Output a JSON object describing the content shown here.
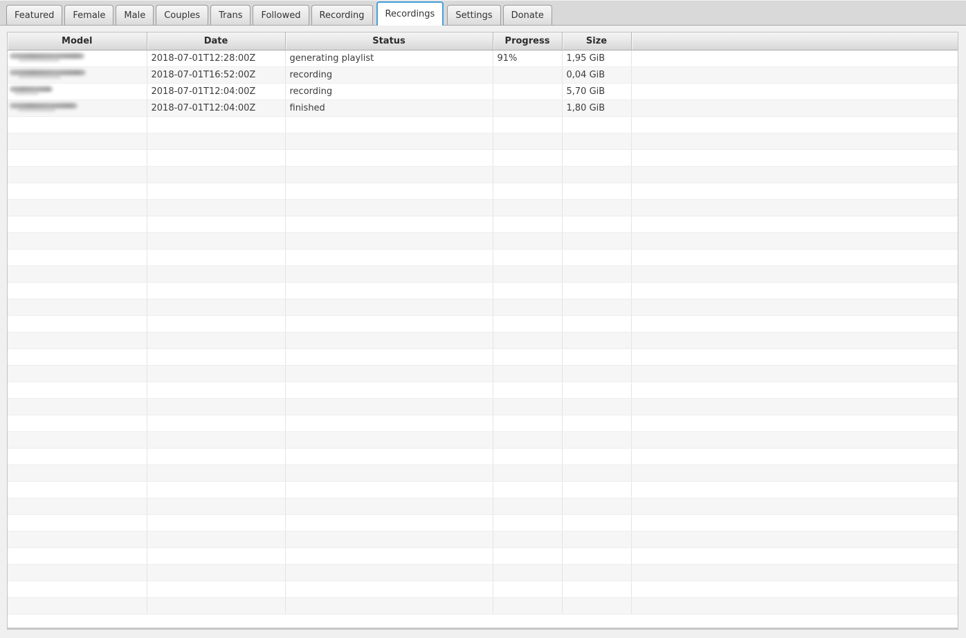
{
  "tabs": [
    {
      "label": "Featured",
      "active": false
    },
    {
      "label": "Female",
      "active": false
    },
    {
      "label": "Male",
      "active": false
    },
    {
      "label": "Couples",
      "active": false
    },
    {
      "label": "Trans",
      "active": false
    },
    {
      "label": "Followed",
      "active": false
    },
    {
      "label": "Recording",
      "active": false
    },
    {
      "label": "Recordings",
      "active": true
    },
    {
      "label": "Settings",
      "active": false
    },
    {
      "label": "Donate",
      "active": false
    }
  ],
  "table": {
    "columns": [
      {
        "key": "model",
        "label": "Model"
      },
      {
        "key": "date",
        "label": "Date"
      },
      {
        "key": "status",
        "label": "Status"
      },
      {
        "key": "progress",
        "label": "Progress"
      },
      {
        "key": "size",
        "label": "Size"
      },
      {
        "key": "spacer",
        "label": ""
      }
    ],
    "rows": [
      {
        "model_redacted": true,
        "model_blur_width": 108,
        "date": "2018-07-01T12:28:00Z",
        "status": "generating playlist",
        "progress": "91%",
        "size": "1,95 GiB"
      },
      {
        "model_redacted": true,
        "model_blur_width": 110,
        "date": "2018-07-01T16:52:00Z",
        "status": "recording",
        "progress": "",
        "size": "0,04 GiB"
      },
      {
        "model_redacted": true,
        "model_blur_width": 62,
        "date": "2018-07-01T12:04:00Z",
        "status": "recording",
        "progress": "",
        "size": "5,70 GiB"
      },
      {
        "model_redacted": true,
        "model_blur_width": 98,
        "date": "2018-07-01T12:04:00Z",
        "status": "finished",
        "progress": "",
        "size": "1,80 GiB"
      }
    ],
    "empty_row_count": 30
  },
  "colors": {
    "active_tab_border": "#44a0d9",
    "header_text": "#2d2d2d",
    "row_stripe": "#f6f6f6"
  }
}
